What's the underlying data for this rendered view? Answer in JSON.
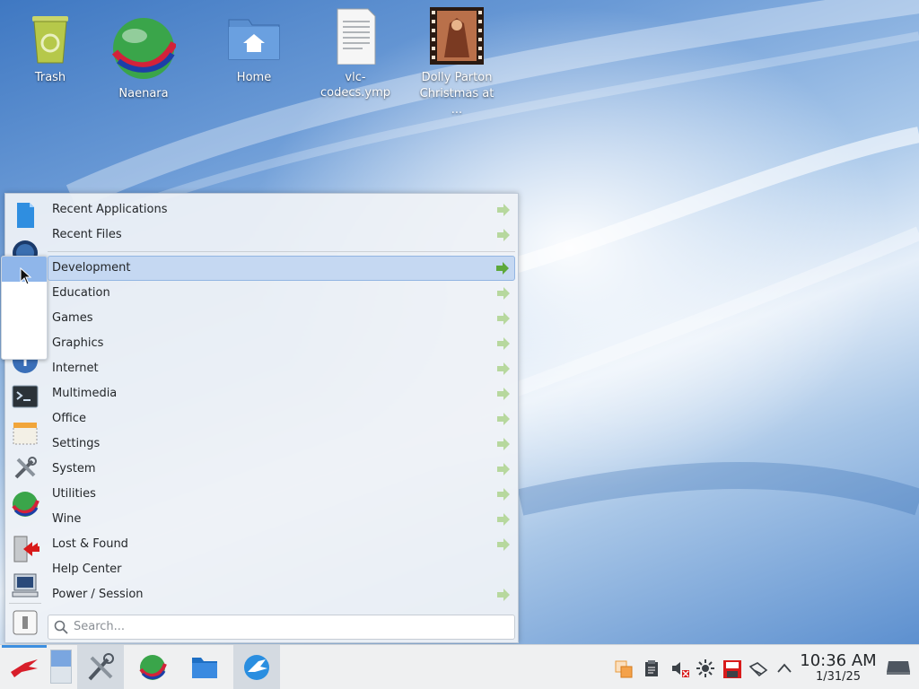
{
  "desktop": {
    "icons": [
      {
        "label": "Trash",
        "icon": "trash-icon"
      },
      {
        "label": "Naenara",
        "icon": "globe-icon"
      },
      {
        "label": "Home",
        "icon": "home-folder-icon"
      },
      {
        "label": "vlc-codecs.ymp",
        "icon": "text-file-icon"
      },
      {
        "label": "Dolly Parton Christmas at ...",
        "icon": "video-thumbnail-icon"
      }
    ]
  },
  "menu": {
    "top_items": [
      {
        "label": "Recent Applications",
        "submenu": true
      },
      {
        "label": "Recent Files",
        "submenu": true
      }
    ],
    "categories": [
      {
        "label": "Development",
        "submenu": true,
        "selected": true
      },
      {
        "label": "Education",
        "submenu": true
      },
      {
        "label": "Games",
        "submenu": true
      },
      {
        "label": "Graphics",
        "submenu": true
      },
      {
        "label": "Internet",
        "submenu": true
      },
      {
        "label": "Multimedia",
        "submenu": true
      },
      {
        "label": "Office",
        "submenu": true
      },
      {
        "label": "Settings",
        "submenu": true
      },
      {
        "label": "System",
        "submenu": true
      },
      {
        "label": "Utilities",
        "submenu": true
      },
      {
        "label": "Wine",
        "submenu": true
      },
      {
        "label": "Lost & Found",
        "submenu": true
      },
      {
        "label": "Help Center",
        "submenu": false
      },
      {
        "label": "Power / Session",
        "submenu": true
      }
    ],
    "search_placeholder": "Search...",
    "sidebar_icons": [
      "document-icon",
      "globe-icon",
      "blank-icon",
      "disc-icon",
      "help-icon",
      "terminal-icon",
      "archive-icon",
      "tools-icon",
      "globe-icon",
      "logout-icon",
      "computer-icon",
      "switch-icon"
    ]
  },
  "taskbar": {
    "buttons": [
      "start-menu-icon",
      "pager-icon",
      "tools-icon",
      "globe-icon",
      "folder-icon",
      "browser-icon"
    ],
    "tray": [
      "notification-icon",
      "clipboard-icon",
      "volume-muted-icon",
      "brightness-icon",
      "save-icon",
      "network-icon",
      "expand-icon",
      "display-icon"
    ],
    "clock": {
      "time": "10:36 AM",
      "date": "1/31/25"
    }
  },
  "colors": {
    "selection": "#c5d8f2",
    "arrow": "#6ab04c",
    "taskbar": "#eff0f1"
  }
}
